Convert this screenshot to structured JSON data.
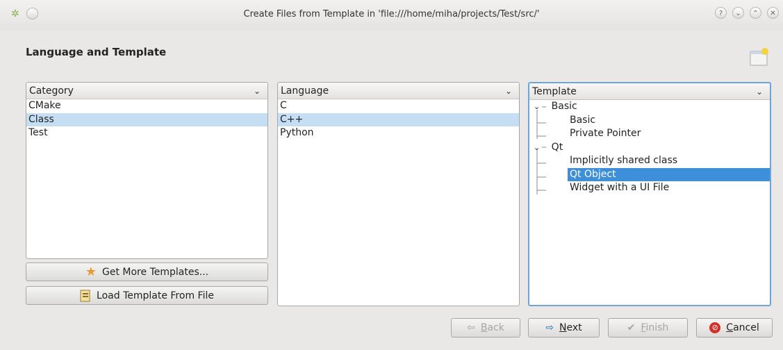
{
  "window": {
    "title": "Create Files from Template in 'file:///home/miha/projects/Test/src/'"
  },
  "page": {
    "heading": "Language and Template"
  },
  "category": {
    "header": "Category",
    "items": [
      "CMake",
      "Class",
      "Test"
    ],
    "selected": "Class"
  },
  "language": {
    "header": "Language",
    "items": [
      "C",
      "C++",
      "Python"
    ],
    "selected": "C++"
  },
  "template": {
    "header": "Template",
    "groups": [
      {
        "label": "Basic",
        "children": [
          "Basic",
          "Private Pointer"
        ]
      },
      {
        "label": "Qt",
        "children": [
          "Implicitly shared class",
          "Qt Object",
          "Widget with a UI File"
        ]
      }
    ],
    "selected": "Qt Object"
  },
  "buttons": {
    "get_more": "Get More Templates...",
    "load_file": "Load Template From File",
    "back_pre": "",
    "back_u": "B",
    "back_post": "ack",
    "next_pre": "",
    "next_u": "N",
    "next_post": "ext",
    "finish_pre": "",
    "finish_u": "F",
    "finish_post": "inish",
    "cancel_pre": "",
    "cancel_u": "C",
    "cancel_post": "ancel"
  },
  "icons": {
    "window_menu": "kde-app-icon",
    "help": "question-mark-icon",
    "minimize": "chevron-down-icon",
    "maximize": "chevron-up-icon",
    "close": "close-icon",
    "get_more": "star-icon",
    "load_file": "document-open-icon",
    "back": "arrow-left-icon",
    "next": "arrow-right-icon",
    "finish": "checkmark-icon",
    "cancel": "cancel-icon"
  },
  "colors": {
    "selection_light": "#c5def4",
    "selection_strong": "#3d8fd9",
    "focus_border": "#6fa4d4",
    "background": "#e9e8e6"
  }
}
